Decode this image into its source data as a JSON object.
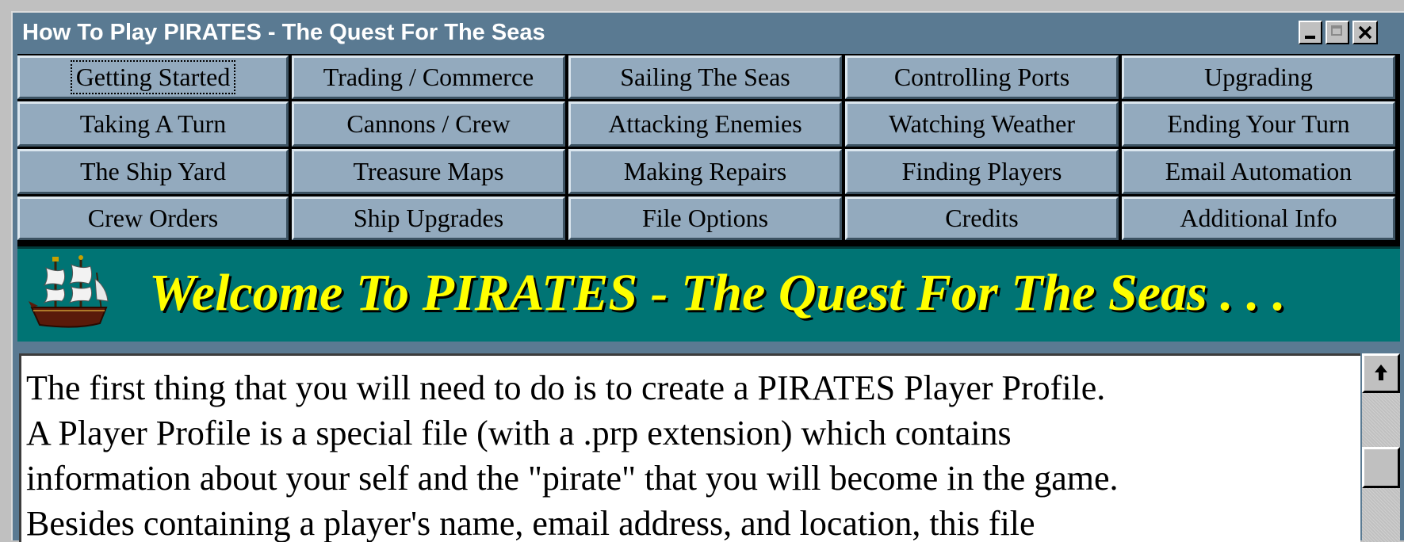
{
  "window": {
    "title": "How To Play PIRATES - The Quest For The Seas"
  },
  "nav": {
    "selected": "Getting Started",
    "buttons": [
      {
        "label": "Getting Started"
      },
      {
        "label": "Trading / Commerce"
      },
      {
        "label": "Sailing The Seas"
      },
      {
        "label": "Controlling Ports"
      },
      {
        "label": "Upgrading"
      },
      {
        "label": "Taking A Turn"
      },
      {
        "label": "Cannons / Crew"
      },
      {
        "label": "Attacking Enemies"
      },
      {
        "label": "Watching Weather"
      },
      {
        "label": "Ending Your Turn"
      },
      {
        "label": "The Ship Yard"
      },
      {
        "label": "Treasure Maps"
      },
      {
        "label": "Making Repairs"
      },
      {
        "label": "Finding Players"
      },
      {
        "label": "Email Automation"
      },
      {
        "label": "Crew Orders"
      },
      {
        "label": "Ship Upgrades"
      },
      {
        "label": "File Options"
      },
      {
        "label": "Credits"
      },
      {
        "label": "Additional Info"
      }
    ]
  },
  "banner": {
    "text": "Welcome To PIRATES - The Quest For The Seas . . .",
    "icon": "pirate-ship-icon"
  },
  "content": {
    "lines": [
      "The first thing that you will need to do is to create a PIRATES Player Profile.",
      "A Player Profile is a special file (with a .prp extension) which contains",
      "information about your self and the \"pirate\" that you will become in the game.",
      "Besides containing a player's name, email address, and location, this file"
    ]
  },
  "colors": {
    "frame": "#5a7a92",
    "button_face": "#93aabe",
    "banner_bg": "#007474",
    "banner_text": "#ffff00"
  }
}
